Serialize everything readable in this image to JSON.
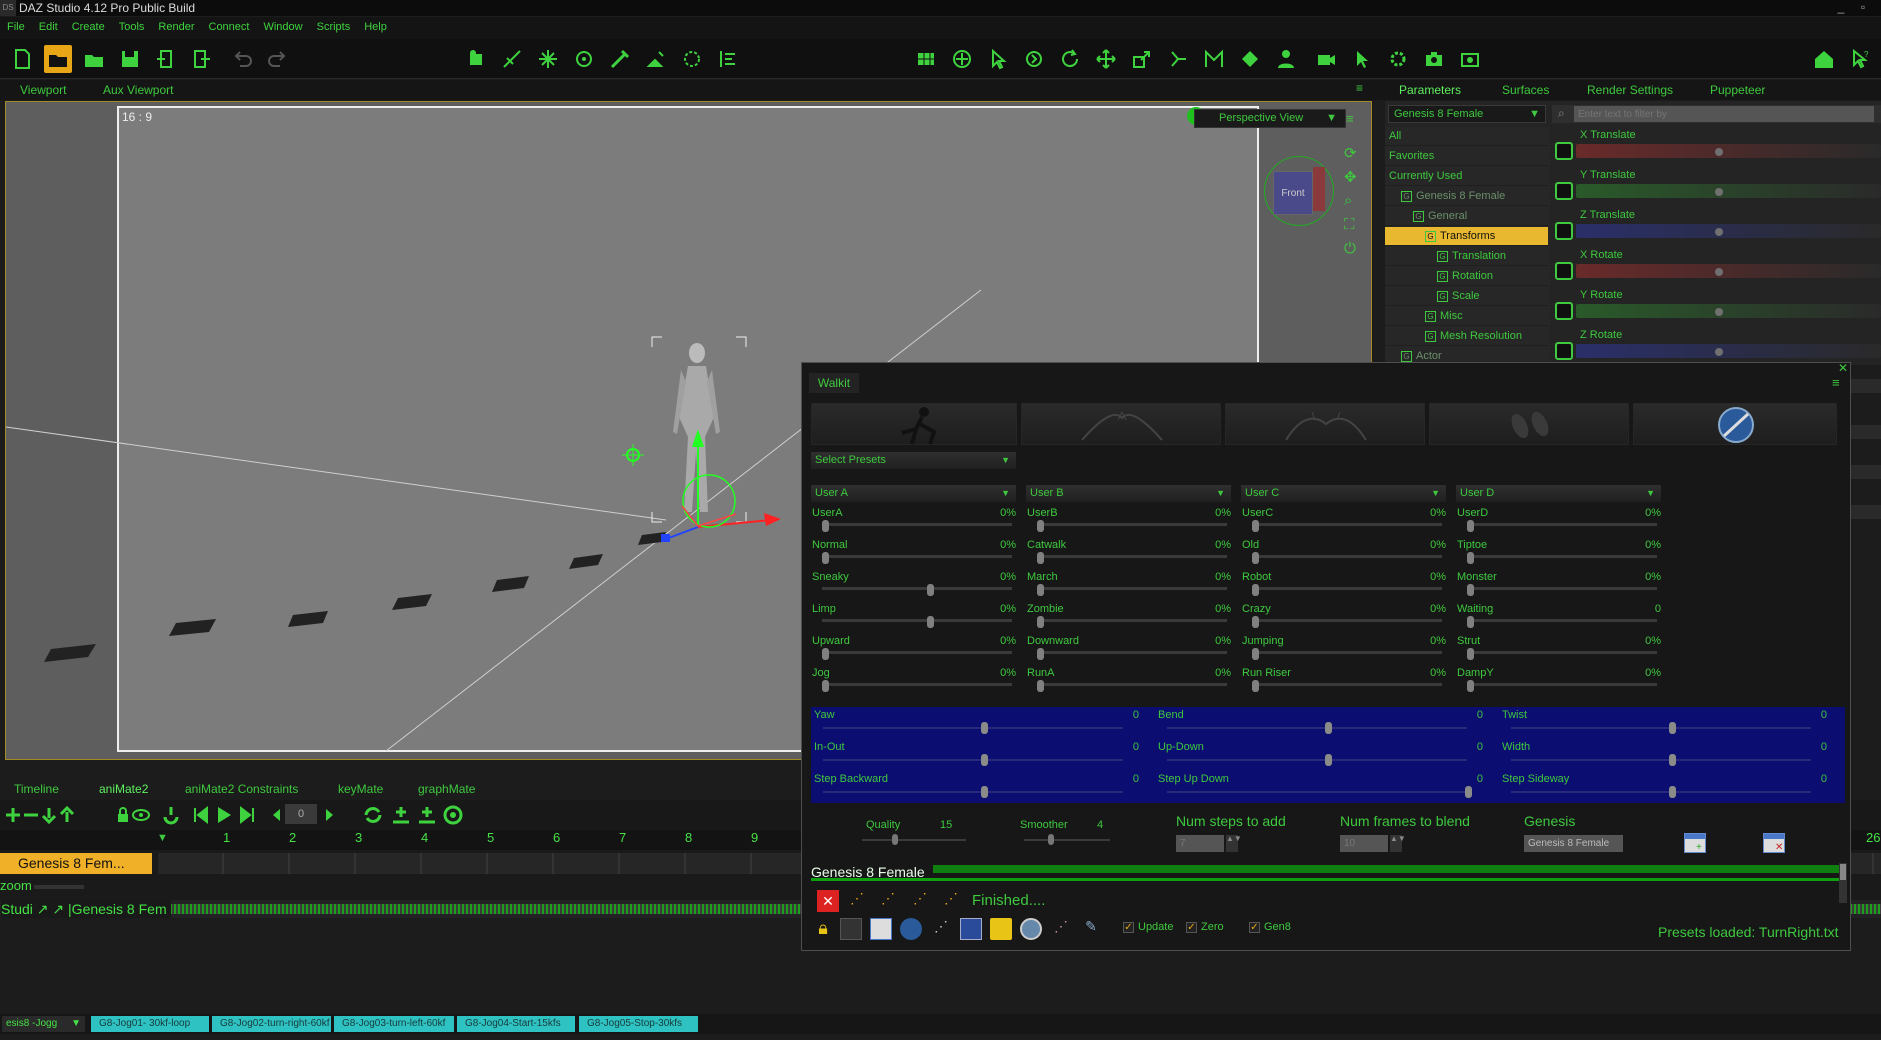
{
  "window": {
    "title": "DAZ Studio 4.12 Pro Public Build",
    "icon_label": "DS"
  },
  "menu": [
    "File",
    "Edit",
    "Create",
    "Tools",
    "Render",
    "Connect",
    "Window",
    "Scripts",
    "Help"
  ],
  "viewport_tabs": [
    "Viewport",
    "Aux Viewport"
  ],
  "viewport": {
    "aspect": "16 : 9",
    "view_name": "Perspective View",
    "cube_face": "Front"
  },
  "params_tabs": [
    "Parameters",
    "Surfaces",
    "Render Settings",
    "Puppeteer"
  ],
  "params": {
    "node_select": "Genesis 8 Female",
    "search_placeholder": "Enter text to filter by",
    "tree": [
      {
        "label": "All",
        "indent": 0
      },
      {
        "label": "Favorites",
        "indent": 0
      },
      {
        "label": "Currently Used",
        "indent": 0
      },
      {
        "label": "Genesis 8 Female",
        "indent": 1
      },
      {
        "label": "General",
        "indent": 2
      },
      {
        "label": "Transforms",
        "indent": 3
      },
      {
        "label": "Translation",
        "indent": 4
      },
      {
        "label": "Rotation",
        "indent": 4
      },
      {
        "label": "Scale",
        "indent": 4
      },
      {
        "label": "Misc",
        "indent": 3
      },
      {
        "label": "Mesh Resolution",
        "indent": 3
      },
      {
        "label": "Actor",
        "indent": 1
      }
    ],
    "sliders": [
      {
        "label": "X Translate",
        "color": "#6a2a2a"
      },
      {
        "label": "Y Translate",
        "color": "#2a5a2a"
      },
      {
        "label": "Z Translate",
        "color": "#2a2f6a"
      },
      {
        "label": "X Rotate",
        "color": "#6a2a2a"
      },
      {
        "label": "Y Rotate",
        "color": "#2a5a2a"
      },
      {
        "label": "Z Rotate",
        "color": "#2a2f6a"
      }
    ]
  },
  "bottom_tabs": [
    "Timeline",
    "aniMate2",
    "aniMate2 Constraints",
    "keyMate",
    "graphMate"
  ],
  "animate": {
    "frame": "0",
    "ruler": [
      "1",
      "2",
      "3",
      "4",
      "5",
      "6",
      "7",
      "8",
      "9"
    ],
    "ruler_end": "26"
  },
  "timeline": {
    "track_label": "Genesis 8 Fem...",
    "zoom_label": "zoom",
    "studio_row": "Studi ↗ ↗ |Genesis 8 Fem"
  },
  "bottom_dropdown": "esis8 -Jogg",
  "clips": [
    "G8-Jog01- 30kf-loop",
    "G8-Jog02-turn-right-60kf",
    "G8-Jog03-turn-left-60kf",
    "G8-Jog04-Start-15kfs",
    "G8-Jog05-Stop-30kfs"
  ],
  "walkit": {
    "title": "Walkit",
    "select_presets": "Select Presets",
    "columns": [
      {
        "header": "User A",
        "rows": [
          [
            "UserA",
            "0%"
          ],
          [
            "Normal",
            "0%"
          ],
          [
            "Sneaky",
            "0%"
          ],
          [
            "Limp",
            "0%"
          ],
          [
            "Upward",
            "0%"
          ],
          [
            "Jog",
            "0%"
          ]
        ]
      },
      {
        "header": "User B",
        "rows": [
          [
            "UserB",
            "0%"
          ],
          [
            "Catwalk",
            "0%"
          ],
          [
            "March",
            "0%"
          ],
          [
            "Zombie",
            "0%"
          ],
          [
            "Downward",
            "0%"
          ],
          [
            "RunA",
            "0%"
          ]
        ]
      },
      {
        "header": "User C",
        "rows": [
          [
            "UserC",
            "0%"
          ],
          [
            "Old",
            "0%"
          ],
          [
            "Robot",
            "0%"
          ],
          [
            "Crazy",
            "0%"
          ],
          [
            "Jumping",
            "0%"
          ],
          [
            "Run Riser",
            "0%"
          ]
        ]
      },
      {
        "header": "User D",
        "rows": [
          [
            "UserD",
            "0%"
          ],
          [
            "Tiptoe",
            "0%"
          ],
          [
            "Monster",
            "0%"
          ],
          [
            "Waiting",
            "0"
          ],
          [
            "Strut",
            "0%"
          ],
          [
            "DampY",
            "0%"
          ]
        ]
      }
    ],
    "blue": [
      [
        [
          "Yaw",
          "0"
        ],
        [
          "In-Out",
          "0"
        ],
        [
          "Step Backward",
          "0"
        ]
      ],
      [
        [
          "Bend",
          "0"
        ],
        [
          "Up-Down",
          "0"
        ],
        [
          "Step Up Down",
          "0"
        ]
      ],
      [
        [
          "Twist",
          "0"
        ],
        [
          "Width",
          "0"
        ],
        [
          "Step Sideway",
          "0"
        ]
      ]
    ],
    "quality_label": "Quality",
    "quality_value": "15",
    "smoother_label": "Smoother",
    "smoother_value": "4",
    "num_steps_label": "Num steps to add",
    "num_steps_value": "7",
    "num_frames_label": "Num frames to blend",
    "num_frames_value": "10",
    "genesis_label": "Genesis",
    "genesis_value": "Genesis 8 Female",
    "figure_name": "Genesis 8 Female",
    "status": "Finished....",
    "checks": [
      {
        "label": "Update"
      },
      {
        "label": "Zero"
      },
      {
        "label": "Gen8"
      }
    ],
    "presets_loaded": "Presets loaded: TurnRight.txt"
  }
}
